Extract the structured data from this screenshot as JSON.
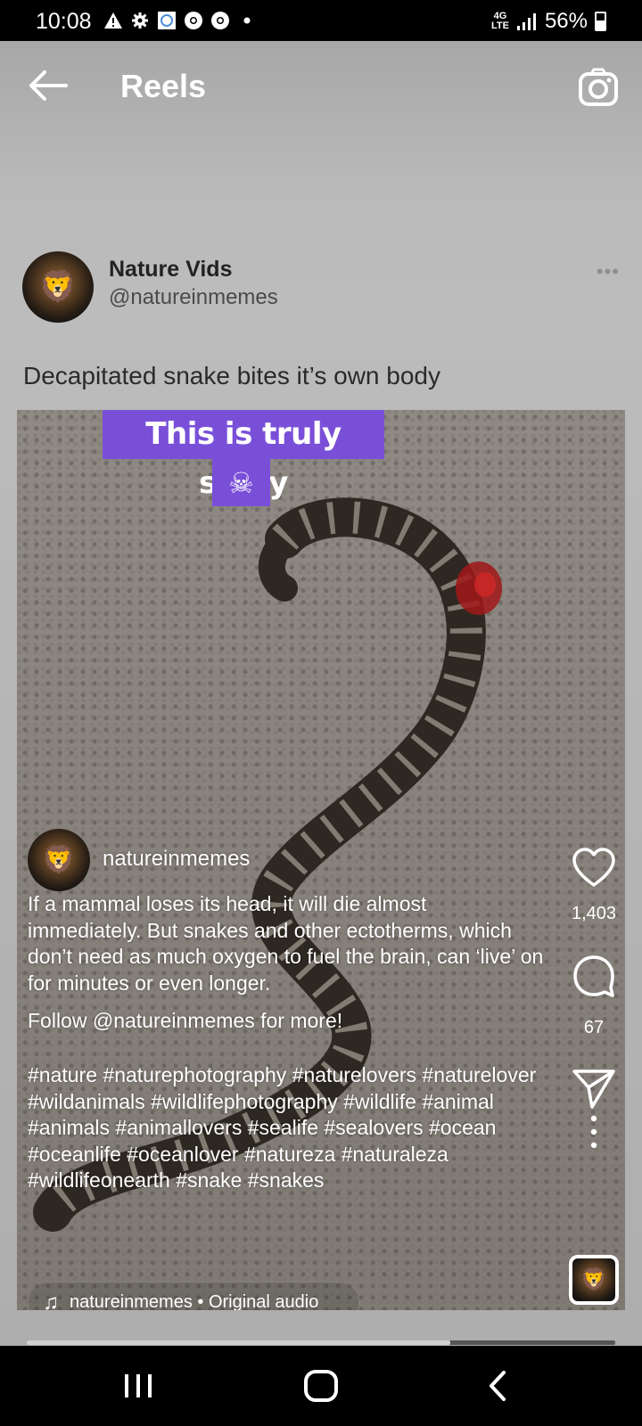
{
  "status_bar": {
    "time": "10:08",
    "notification_icons": [
      "warning-icon",
      "settings-icon",
      "app-icon",
      "chrome-icon",
      "chrome-icon",
      "dot-icon"
    ],
    "network_top": "4G",
    "network_bottom": "LTE",
    "battery_text": "56%",
    "battery_level": 0.56
  },
  "header": {
    "title": "Reels",
    "back_icon": "back-arrow-icon",
    "camera_icon": "camera-icon"
  },
  "post": {
    "author_name": "Nature Vids",
    "author_handle": "@natureinmemes",
    "more_label": "•••",
    "text": "Decapitated snake bites it’s own body"
  },
  "video": {
    "banner_text": "This is truly scary",
    "banner_emoji": "☠",
    "creator_username": "natureinmemes",
    "description": "If a mammal loses its head, it will die almost immediately. But snakes and other ectotherms, which don’t need as much oxygen to fuel the brain, can ‘live’ on for minutes or even longer.",
    "follow_text": "Follow @natureinmemes for more!",
    "hashtags": "#nature #naturephotography #naturelovers #naturelover #wildanimals #wildlifephotography #wildlife #animal #animals #animallovers #sealife #sealovers #ocean #oceanlife #oceanlover #natureza #naturaleza #wildlifeonearth #snake #snakes",
    "audio_label": "natureinmemes • Original audio",
    "likes": "1,403",
    "comments": "67",
    "progress": 0.72
  },
  "colors": {
    "banner": "#7a4fd8",
    "background": "#b7b7b7"
  }
}
